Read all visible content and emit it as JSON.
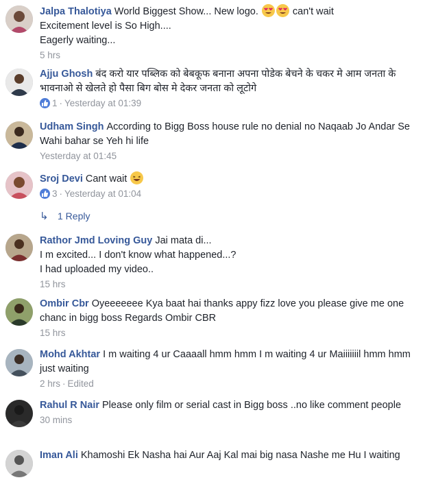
{
  "comments": [
    {
      "name": "Jalpa Thalotiya",
      "text_before": "World Biggest Show... New logo.",
      "emoji": "heart-eyes-emoji",
      "text_after": "can't wait",
      "lines": [
        "Excitement level is So High....",
        "Eagerly waiting..."
      ],
      "time": "5 hrs"
    },
    {
      "name": "Ajju Ghosh",
      "text": "बंद करो यार पब्लिक को बेबकूफ बनाना अपना पोडेक बेचने के चकर मे आम जनता के भावनाओ से खेलते हो पैसा बिग बोस मे देकर जनता को लूटोगे",
      "likes": "1",
      "time": "Yesterday at 01:39"
    },
    {
      "name": "Udham Singh",
      "text": "According to Bigg Boss house rule no denial no Naqaab Jo Andar Se Wahi bahar se Yeh hi life",
      "time": "Yesterday at 01:45"
    },
    {
      "name": "Sroj Devi",
      "text": "Cant wait",
      "likes": "3",
      "time": "Yesterday at 01:04"
    },
    {
      "name": "Rathor Jmd Loving Guy",
      "text": "Jai mata di...",
      "lines": [
        "I m excited... I don't know what happened...?",
        "I had uploaded my video.."
      ],
      "time": "15 hrs"
    },
    {
      "name": "Ombir Cbr",
      "text": "Oyeeeeeee Kya baat hai thanks appy fizz love you please give me one chanc in bigg boss Regards Ombir CBR",
      "time": "15 hrs"
    },
    {
      "name": "Mohd Akhtar",
      "text": "I m waiting 4 ur Caaaall hmm hmm I m waiting 4 ur Maiiiiiiil hmm hmm just waiting",
      "time": "2 hrs",
      "edited": "Edited"
    },
    {
      "name": "Rahul R Nair",
      "text": "Please only film or serial cast in Bigg boss ..no like comment people",
      "time": "30 mins"
    },
    {
      "name": "Iman Ali",
      "text": "Khamoshi Ek Nasha hai Aur Aaj Kal mai big nasa Nashe me Hu I waiting"
    }
  ],
  "reply_link": "1 Reply",
  "colors": {
    "name": "#365899",
    "meta": "#90949c",
    "like": "#4f7dd8",
    "text": "#1d2129"
  }
}
